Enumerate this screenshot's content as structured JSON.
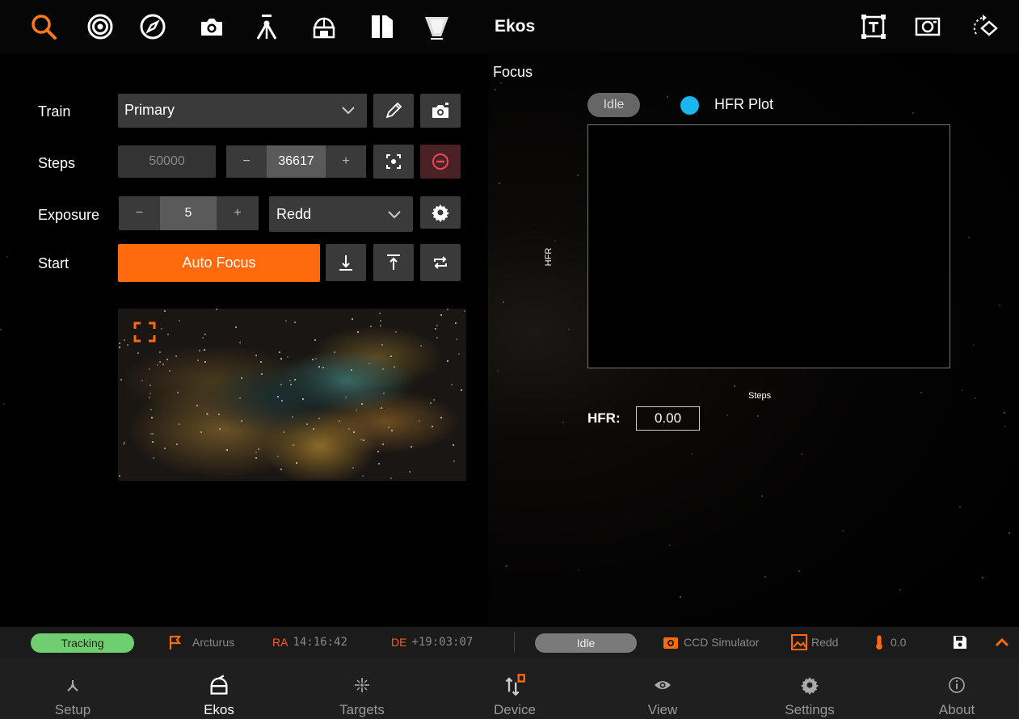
{
  "app": {
    "title": "Ekos",
    "page_title": "Focus"
  },
  "toolbar": {
    "left_icons": [
      "search-icon",
      "target-icon",
      "compass-icon",
      "camera-icon",
      "tripod-icon",
      "observatory-icon",
      "filter-wheel-icon",
      "flat-panel-icon"
    ],
    "right_icons": [
      "text-frame-icon",
      "camera-frame-icon",
      "rotator-icon"
    ],
    "accent": "#ff7a1a"
  },
  "form": {
    "train_label": "Train",
    "train_value": "Primary",
    "steps_label": "Steps",
    "steps_max": "50000",
    "steps_minus": "−",
    "steps_value": "36617",
    "steps_plus": "+",
    "exposure_label": "Exposure",
    "exposure_minus": "−",
    "exposure_value": "5",
    "exposure_plus": "+",
    "filter_value": "Redd",
    "start_label": "Start",
    "autofocus_label": "Auto Focus"
  },
  "plot": {
    "status": "Idle",
    "legend": "HFR Plot",
    "legend_color": "#19b6f0",
    "y_axis": "HFR",
    "x_axis": "Steps",
    "hfr_label": "HFR:",
    "hfr_value": "0.00"
  },
  "status_bar": {
    "tracking": "Tracking",
    "target_name": "Arcturus",
    "ra_label": "RA",
    "ra_value": "14:16:42",
    "de_label": "DE",
    "de_value": "+19:03:07",
    "state": "Idle",
    "camera": "CCD Simulator",
    "filter": "Redd",
    "temperature": "0.0",
    "colors": {
      "tracking": "#6fcf6f",
      "coords": "#ff5a1f",
      "orange": "#ff6a0c"
    }
  },
  "nav": {
    "items": [
      {
        "label": "Setup",
        "icon": "setup-icon"
      },
      {
        "label": "Ekos",
        "icon": "ekos-icon",
        "active": true
      },
      {
        "label": "Targets",
        "icon": "targets-icon"
      },
      {
        "label": "Device",
        "icon": "device-icon"
      },
      {
        "label": "View",
        "icon": "view-icon"
      },
      {
        "label": "Settings",
        "icon": "settings-icon"
      },
      {
        "label": "About",
        "icon": "about-icon"
      }
    ]
  }
}
